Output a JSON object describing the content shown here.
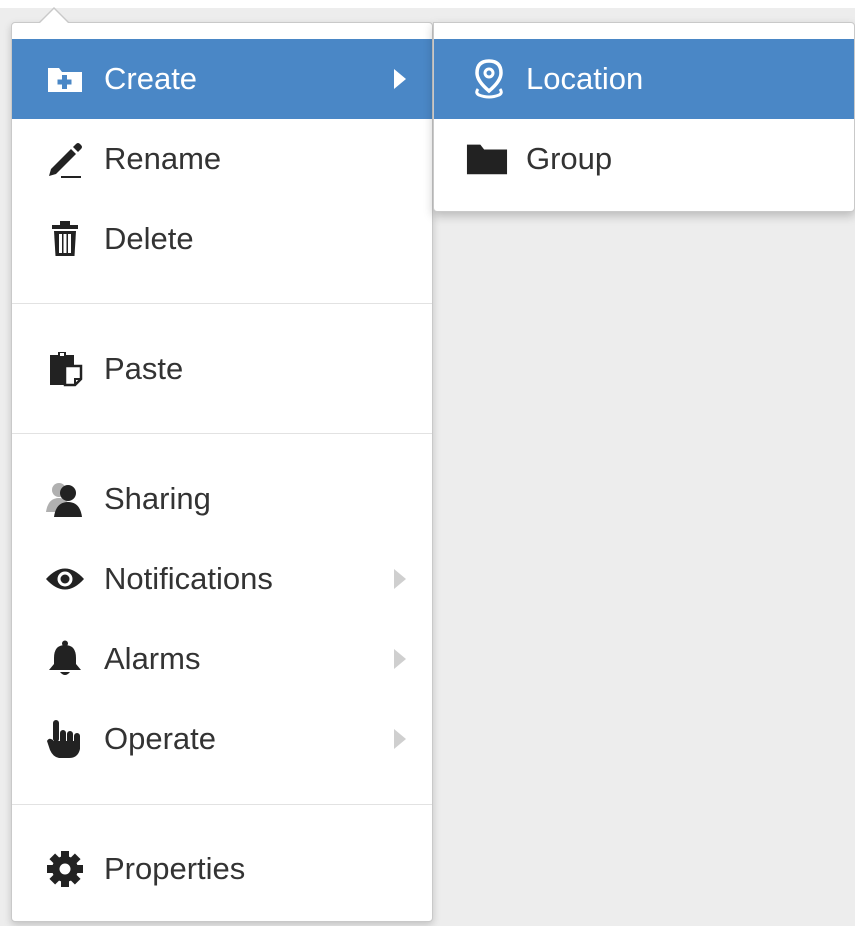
{
  "menu": {
    "items": [
      {
        "label": "Create",
        "icon": "folder-plus-icon",
        "active": true,
        "submenu": true
      },
      {
        "label": "Rename",
        "icon": "pencil-icon"
      },
      {
        "label": "Delete",
        "icon": "trash-icon"
      },
      {
        "label": "Paste",
        "icon": "paste-icon"
      },
      {
        "label": "Sharing",
        "icon": "users-icon"
      },
      {
        "label": "Notifications",
        "icon": "eye-icon",
        "submenu": true
      },
      {
        "label": "Alarms",
        "icon": "bell-icon",
        "submenu": true
      },
      {
        "label": "Operate",
        "icon": "hand-pointer-icon",
        "submenu": true
      },
      {
        "label": "Properties",
        "icon": "gear-icon"
      }
    ]
  },
  "submenu": {
    "items": [
      {
        "label": "Location",
        "icon": "map-pin-icon",
        "active": true
      },
      {
        "label": "Group",
        "icon": "folder-icon"
      }
    ]
  },
  "colors": {
    "accent": "#4a87c6",
    "text": "#333333",
    "background": "#ededed"
  }
}
